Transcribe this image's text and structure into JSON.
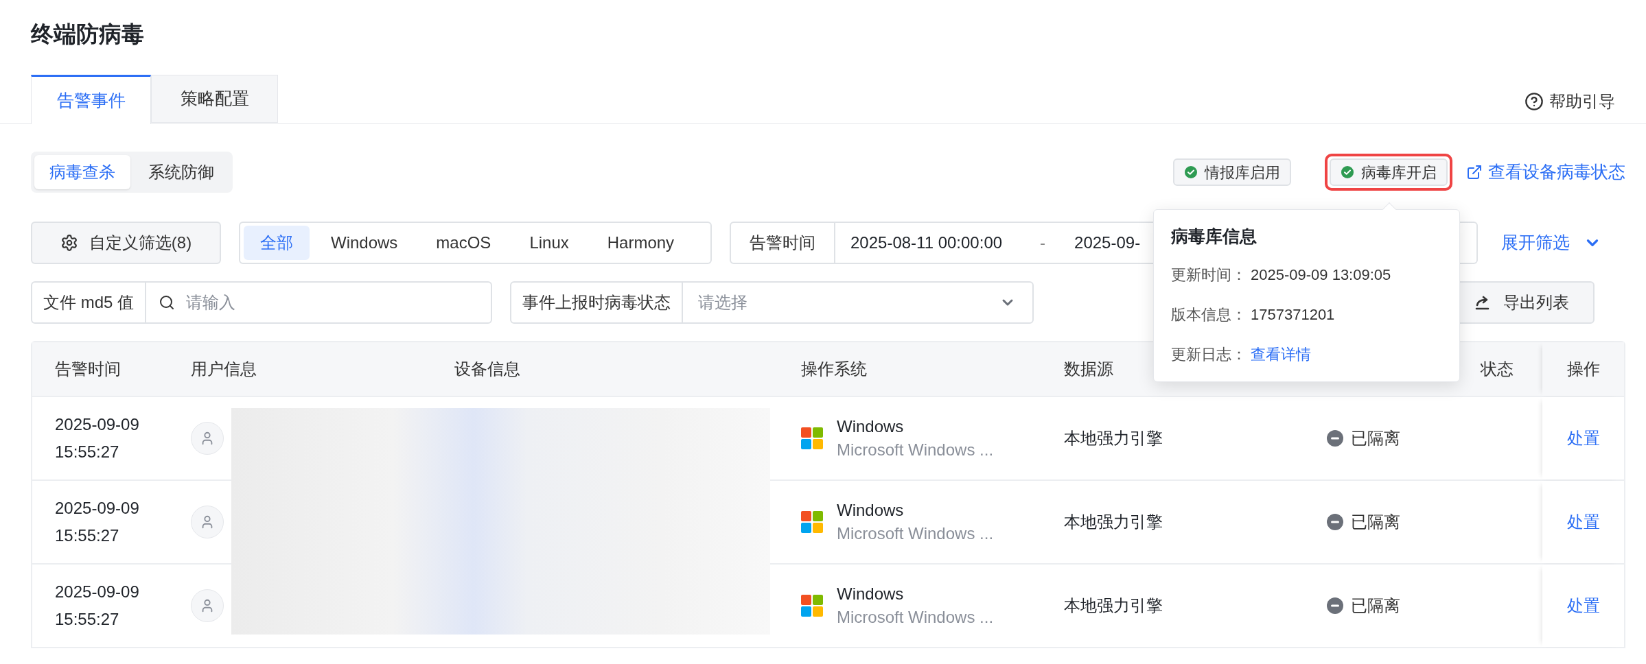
{
  "page_title": "终端防病毒",
  "tabs": [
    {
      "label": "告警事件",
      "selected": true
    },
    {
      "label": "策略配置",
      "selected": false
    }
  ],
  "help_link": "帮助引导",
  "mode_switch": [
    {
      "label": "病毒查杀",
      "selected": true
    },
    {
      "label": "系统防御",
      "selected": false
    }
  ],
  "status_badges": [
    {
      "label": "情报库启用",
      "on": true,
      "highlighted": false
    },
    {
      "label": "病毒库开启",
      "on": true,
      "highlighted": true
    }
  ],
  "device_status_link": "查看设备病毒状态",
  "custom_filter_button": "自定义筛选(8)",
  "os_filter": [
    {
      "label": "全部",
      "selected": true
    },
    {
      "label": "Windows",
      "selected": false
    },
    {
      "label": "macOS",
      "selected": false
    },
    {
      "label": "Linux",
      "selected": false
    },
    {
      "label": "Harmony",
      "selected": false
    }
  ],
  "alert_time": {
    "label": "告警时间",
    "start": "2025-08-11 00:00:00",
    "separator": "-",
    "end": "2025-09-"
  },
  "expand_filter": "展开筛选",
  "md5_filter": {
    "label": "文件 md5 值",
    "placeholder": "请输入"
  },
  "status_filter": {
    "label": "事件上报时病毒状态",
    "placeholder": "请选择"
  },
  "export_button": "导出列表",
  "table": {
    "columns": [
      "告警时间",
      "用户信息",
      "设备信息",
      "操作系统",
      "数据源",
      "状态",
      "操作"
    ],
    "rows": [
      {
        "time": "2025-09-09 15:55:27",
        "os_name": "Windows",
        "os_detail": "Microsoft Windows ...",
        "source": "本地强力引擎",
        "status": "已隔离",
        "action": "处置"
      },
      {
        "time": "2025-09-09 15:55:27",
        "os_name": "Windows",
        "os_detail": "Microsoft Windows ...",
        "source": "本地强力引擎",
        "status": "已隔离",
        "action": "处置"
      },
      {
        "time": "2025-09-09 15:55:27",
        "os_name": "Windows",
        "os_detail": "Microsoft Windows ...",
        "source": "本地强力引擎",
        "status": "已隔离",
        "action": "处置"
      }
    ]
  },
  "popover": {
    "title": "病毒库信息",
    "fields": [
      {
        "label": "更新时间：",
        "value": "2025-09-09 13:09:05",
        "kind": "text"
      },
      {
        "label": "版本信息：",
        "value": "1757371201",
        "kind": "text"
      },
      {
        "label": "更新日志：",
        "value": "查看详情",
        "kind": "link"
      }
    ]
  }
}
